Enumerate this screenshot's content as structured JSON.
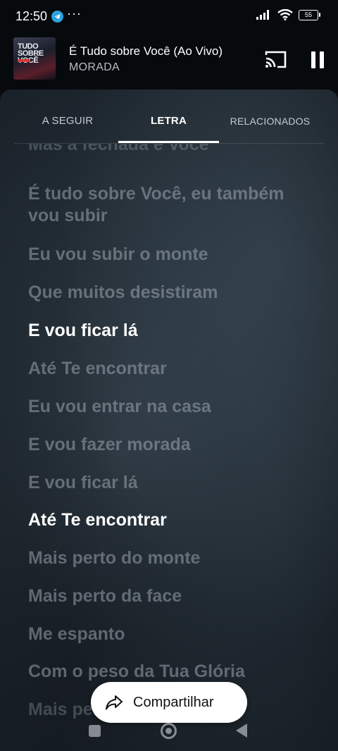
{
  "status_bar": {
    "time": "12:50",
    "more": "···",
    "battery": "55"
  },
  "player": {
    "album_art_text": "TUDO SOBRE VOCÊ",
    "title": "É Tudo sobre Você (Ao Vivo)",
    "artist": "MORADA",
    "state": "playing"
  },
  "tabs": [
    {
      "label": "A SEGUIR",
      "active": false
    },
    {
      "label": "LETRA",
      "active": true
    },
    {
      "label": "RELACIONADOS",
      "active": false
    }
  ],
  "lyrics": [
    {
      "text": "Mas a fechada é Você",
      "state": "fade"
    },
    {
      "text": "É tudo sobre Você, eu também vou subir",
      "state": "dim"
    },
    {
      "text": "Eu vou subir o monte",
      "state": "dim"
    },
    {
      "text": "Que muitos desistiram",
      "state": "dim"
    },
    {
      "text": "E vou ficar lá",
      "state": "on"
    },
    {
      "text": "Até Te encontrar",
      "state": "dim"
    },
    {
      "text": "Eu vou entrar na casa",
      "state": "dim"
    },
    {
      "text": "E vou fazer morada",
      "state": "dim"
    },
    {
      "text": "E vou ficar lá",
      "state": "dim"
    },
    {
      "text": "Até Te encontrar",
      "state": "on"
    },
    {
      "text": "Mais perto do monte",
      "state": "dim"
    },
    {
      "text": "Mais perto da face",
      "state": "dim"
    },
    {
      "text": "Me espanto",
      "state": "dim"
    },
    {
      "text": "Com o peso da Tua Glória",
      "state": "dim"
    },
    {
      "text": "Mais perto",
      "state": "dim"
    }
  ],
  "share": {
    "label": "Compartilhar"
  },
  "colors": {
    "sheet": "#27323b",
    "active_tab": "#ffffff",
    "dim_lyric": "#a5b0ba"
  }
}
